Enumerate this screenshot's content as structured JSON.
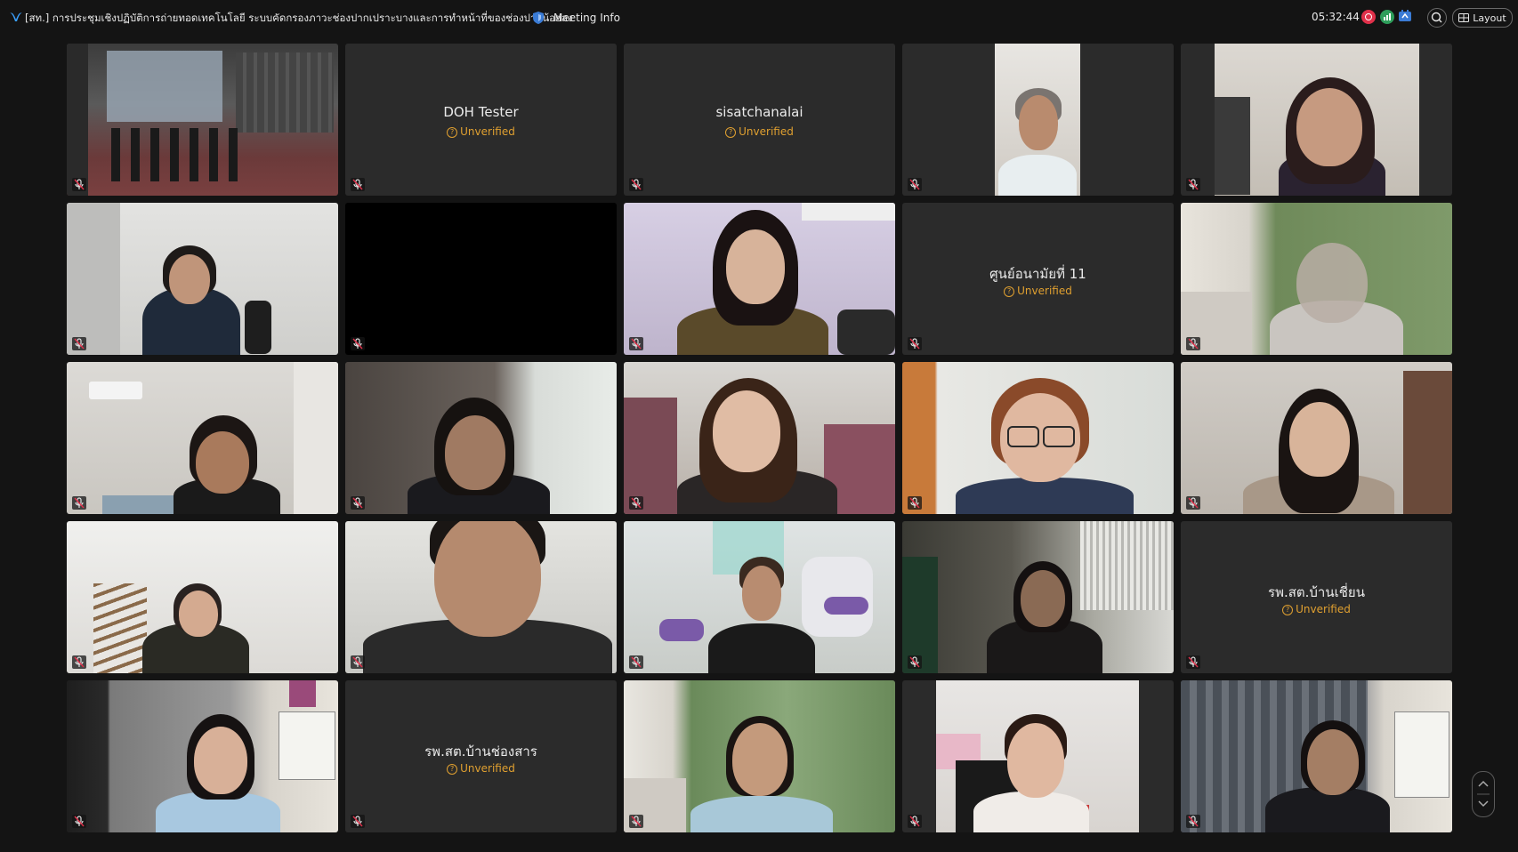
{
  "topbar": {
    "title": "[สท.] การประชุมเชิงปฏิบัติการถ่ายทอดเทคโนโลยี ระบบคัดกรองภาวะช่องปากเปราะบางและการทำหน้าที่ของช่องปากน้อยลง",
    "meeting_info_label": "Meeting Info",
    "clock": "05:32:44",
    "layout_label": "Layout"
  },
  "unverified_label": "Unverified",
  "tiles": [
    {
      "name": ""
    },
    {
      "name": "DOH Tester"
    },
    {
      "name": "sisatchanalai"
    },
    {
      "name": ""
    },
    {
      "name": ""
    },
    {
      "name": ""
    },
    {
      "name": ""
    },
    {
      "name": ""
    },
    {
      "name": "ศูนย์อนามัยที่ 11"
    },
    {
      "name": ""
    },
    {
      "name": ""
    },
    {
      "name": ""
    },
    {
      "name": ""
    },
    {
      "name": ""
    },
    {
      "name": ""
    },
    {
      "name": ""
    },
    {
      "name": ""
    },
    {
      "name": ""
    },
    {
      "name": ""
    },
    {
      "name": "รพ.สต.บ้านเชี่ยน"
    },
    {
      "name": ""
    },
    {
      "name": "รพ.สต.บ้านช่องสาร"
    },
    {
      "name": ""
    },
    {
      "name": ""
    },
    {
      "name": ""
    }
  ],
  "colors": {
    "background": "#141414",
    "tile": "#2b2b2b",
    "unverified": "#e0a030",
    "record": "#e0304a",
    "stats": "#2e9e5b",
    "share": "#3a7bd5"
  }
}
